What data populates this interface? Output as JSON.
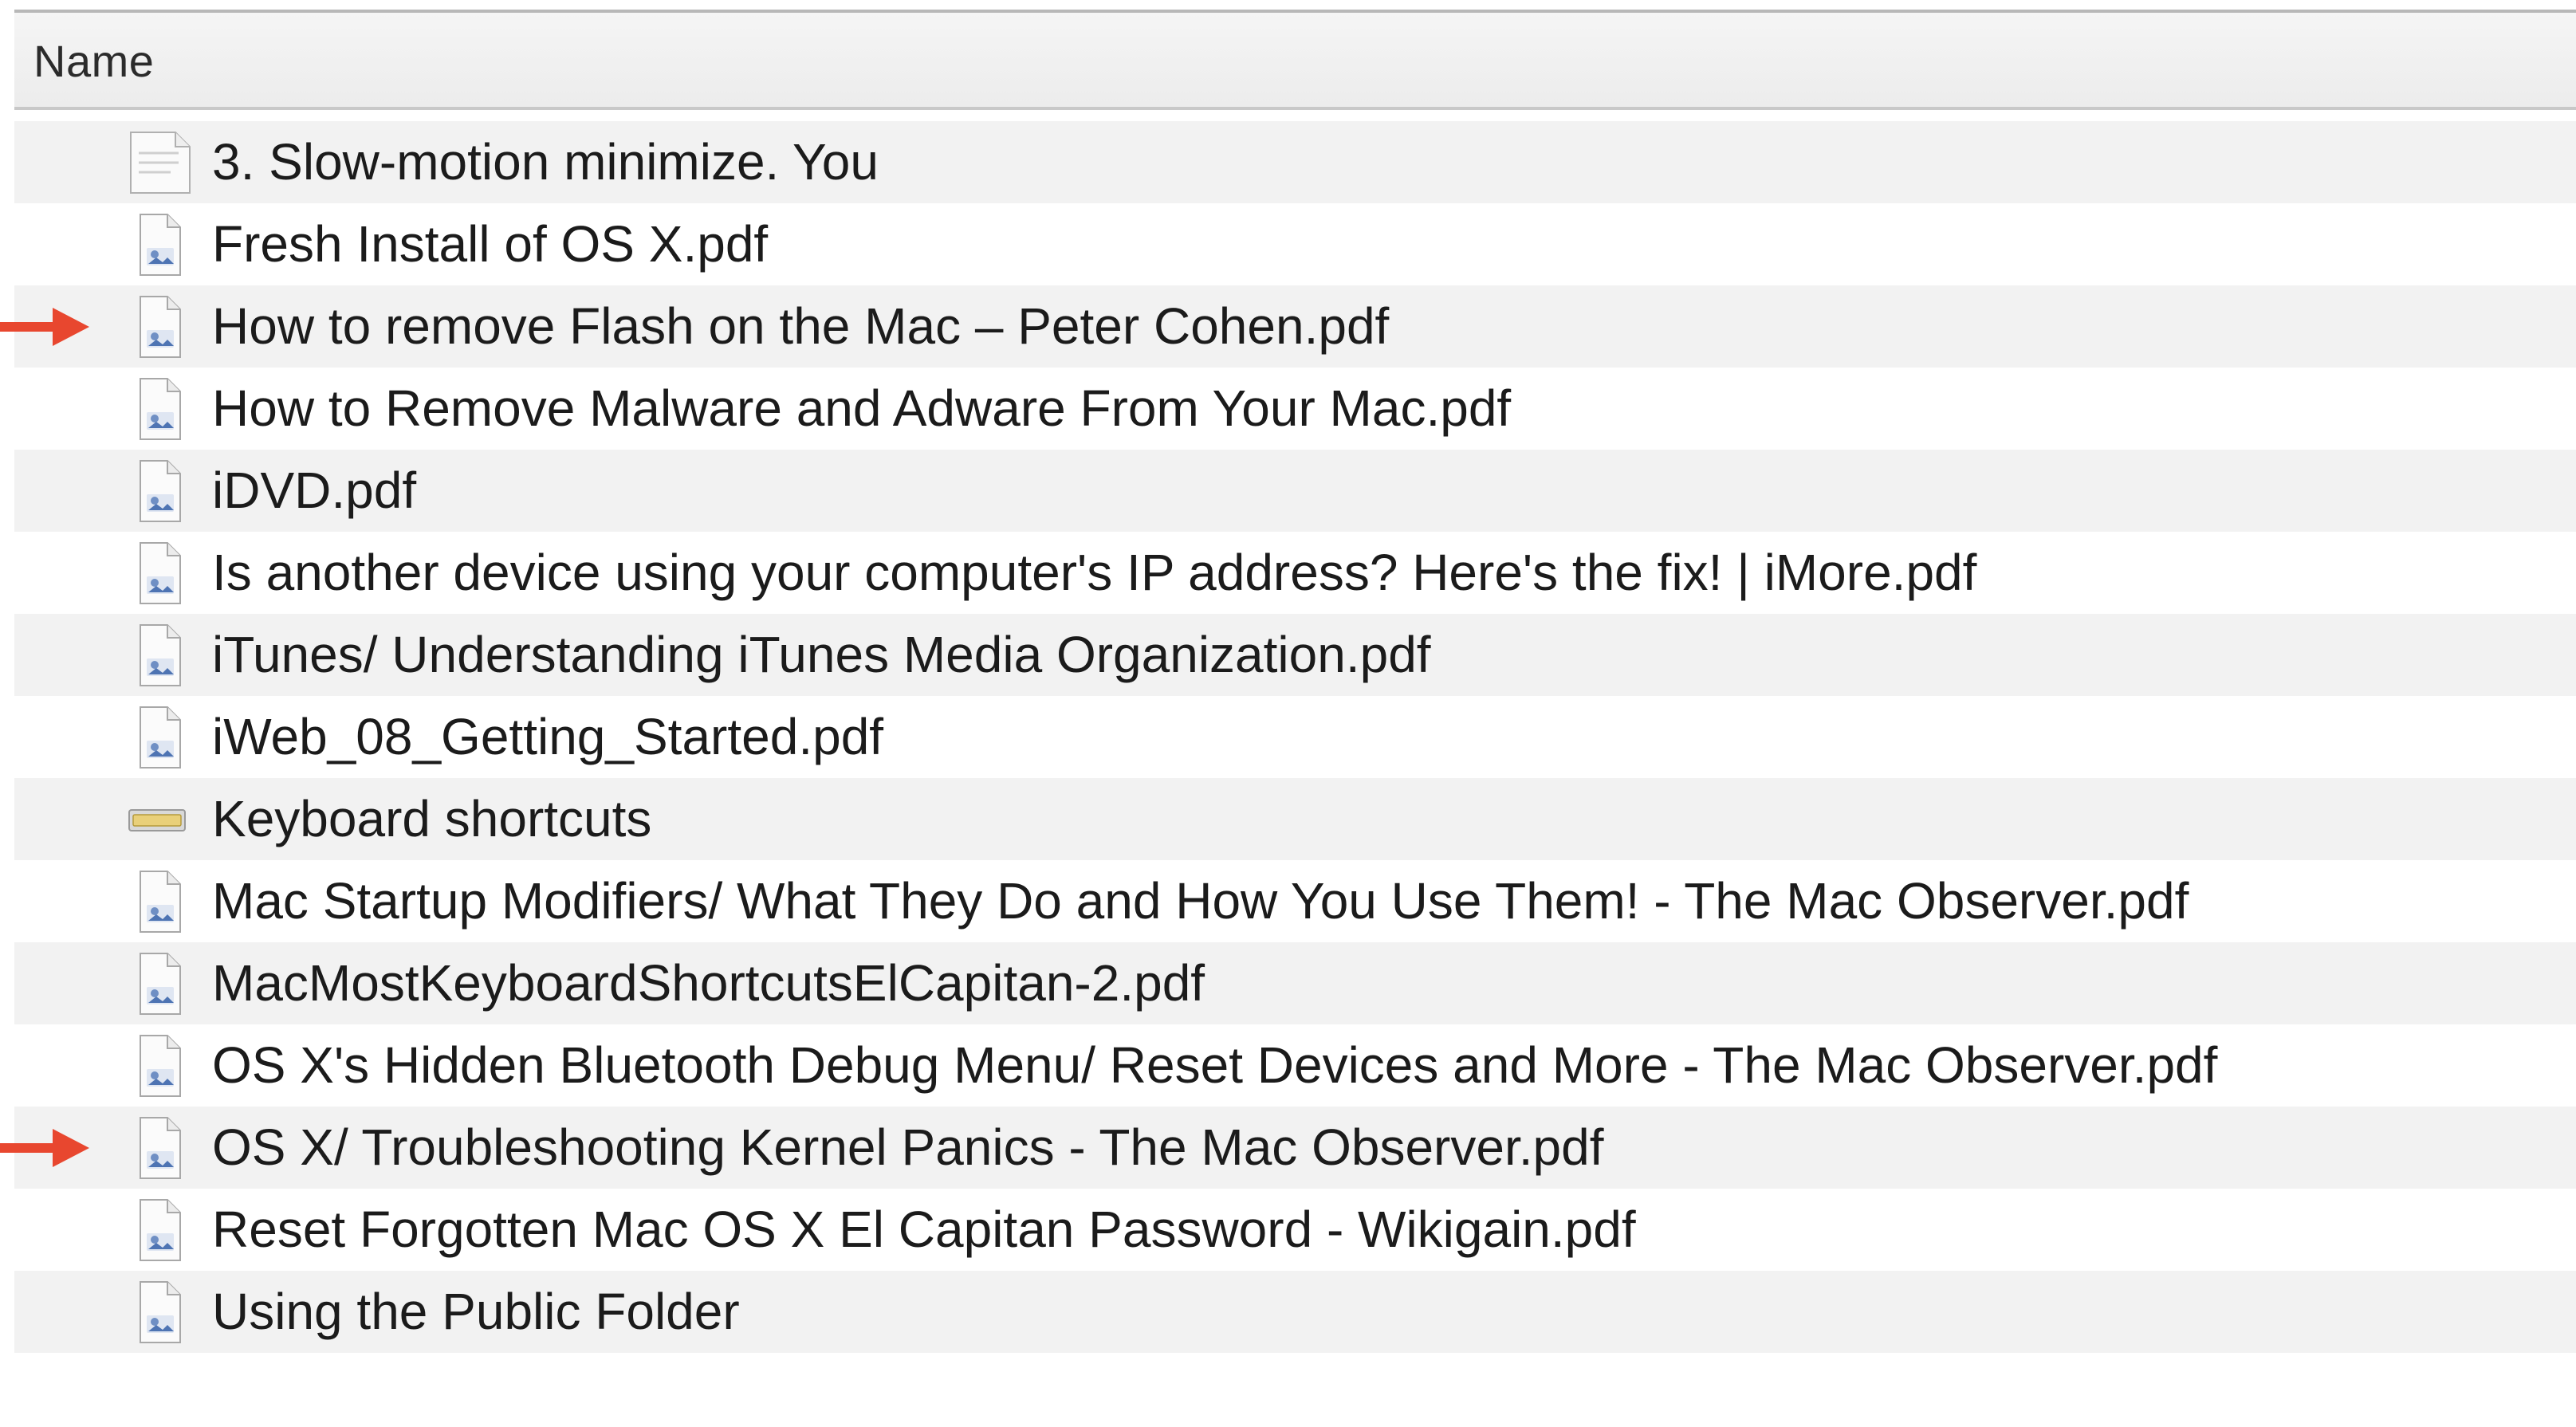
{
  "header": {
    "name_column_label": "Name"
  },
  "colors": {
    "accent_arrow": "#e8472f",
    "row_stripe": "#f2f2f2",
    "text": "#1b1b1b"
  },
  "files": [
    {
      "name": "3. Slow-motion minimize. You",
      "icon": "text-document-icon",
      "highlighted": false
    },
    {
      "name": "Fresh Install of OS X.pdf",
      "icon": "pdf-document-icon",
      "highlighted": false
    },
    {
      "name": "How to remove Flash on the Mac – Peter Cohen.pdf",
      "icon": "pdf-document-icon",
      "highlighted": true
    },
    {
      "name": "How to Remove Malware and Adware From Your Mac.pdf",
      "icon": "pdf-document-icon",
      "highlighted": false
    },
    {
      "name": "iDVD.pdf",
      "icon": "pdf-document-icon",
      "highlighted": false
    },
    {
      "name": "Is another device using your computer's IP address? Here's the fix! | iMore.pdf",
      "icon": "pdf-document-icon",
      "highlighted": false
    },
    {
      "name": "iTunes/ Understanding iTunes Media Organization.pdf",
      "icon": "pdf-document-icon",
      "highlighted": false
    },
    {
      "name": "iWeb_08_Getting_Started.pdf",
      "icon": "pdf-document-icon",
      "highlighted": false
    },
    {
      "name": "Keyboard shortcuts",
      "icon": "keyboard-icon",
      "highlighted": false
    },
    {
      "name": "Mac Startup Modifiers/ What They Do and How You Use Them! - The Mac Observer.pdf",
      "icon": "pdf-document-icon",
      "highlighted": false
    },
    {
      "name": "MacMostKeyboardShortcutsElCapitan-2.pdf",
      "icon": "pdf-document-icon",
      "highlighted": false
    },
    {
      "name": "OS X's Hidden Bluetooth Debug Menu/ Reset Devices and More - The Mac Observer.pdf",
      "icon": "pdf-document-icon",
      "highlighted": false
    },
    {
      "name": "OS X/ Troubleshooting Kernel Panics - The Mac Observer.pdf",
      "icon": "pdf-document-icon",
      "highlighted": true
    },
    {
      "name": "Reset Forgotten Mac OS X El Capitan Password - Wikigain.pdf",
      "icon": "pdf-document-icon",
      "highlighted": false
    },
    {
      "name": "Using the Public Folder",
      "icon": "pdf-document-icon",
      "highlighted": false
    }
  ]
}
